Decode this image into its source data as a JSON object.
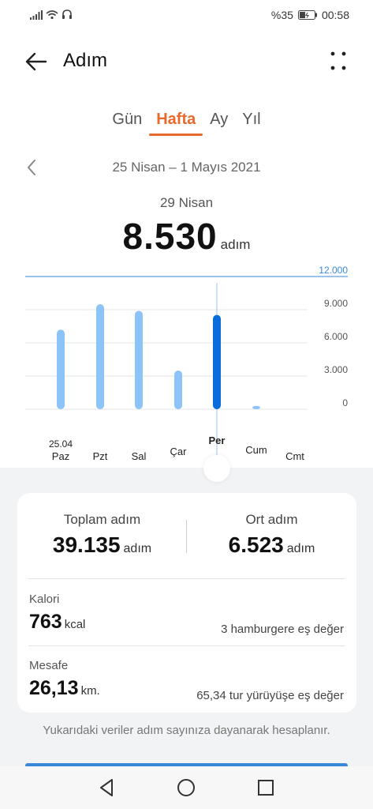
{
  "status": {
    "battery": "%35",
    "time": "00:58"
  },
  "header": {
    "title": "Adım"
  },
  "tabs": [
    {
      "label": "Gün"
    },
    {
      "label": "Hafta",
      "active": true
    },
    {
      "label": "Ay"
    },
    {
      "label": "Yıl"
    }
  ],
  "range": {
    "label": "25 Nisan – 1 Mayıs 2021"
  },
  "selected": {
    "date": "29 Nisan",
    "value": "8.530",
    "unit": "adım"
  },
  "chart_data": {
    "type": "bar",
    "categories": [
      "Paz",
      "Pzt",
      "Sal",
      "Çar",
      "Per",
      "Cum",
      "Cmt"
    ],
    "date_label": "25.04",
    "values": [
      7200,
      9500,
      8900,
      3500,
      8530,
      300,
      0
    ],
    "selected_index": 4,
    "ylim": [
      0,
      12000
    ],
    "yticks": [
      "12.000",
      "9.000",
      "6.000",
      "3.000",
      "0"
    ],
    "goal_label": "12.000",
    "colors": {
      "bar": "#8cc4f8",
      "selected": "#0a6ddb",
      "goal": "#3a87d8"
    }
  },
  "summary": {
    "total_label": "Toplam adım",
    "total_value": "39.135",
    "total_unit": "adım",
    "avg_label": "Ort adım",
    "avg_value": "6.523",
    "avg_unit": "adım"
  },
  "calories": {
    "label": "Kalori",
    "value": "763",
    "unit": "kcal",
    "equivalent": "3 hamburgere eş değer"
  },
  "distance": {
    "label": "Mesafe",
    "value": "26,13",
    "unit": "km.",
    "equivalent": "65,34 tur yürüyüşe eş değer"
  },
  "note": "Yukarıdaki veriler adım sayınıza dayanarak hesaplanır."
}
